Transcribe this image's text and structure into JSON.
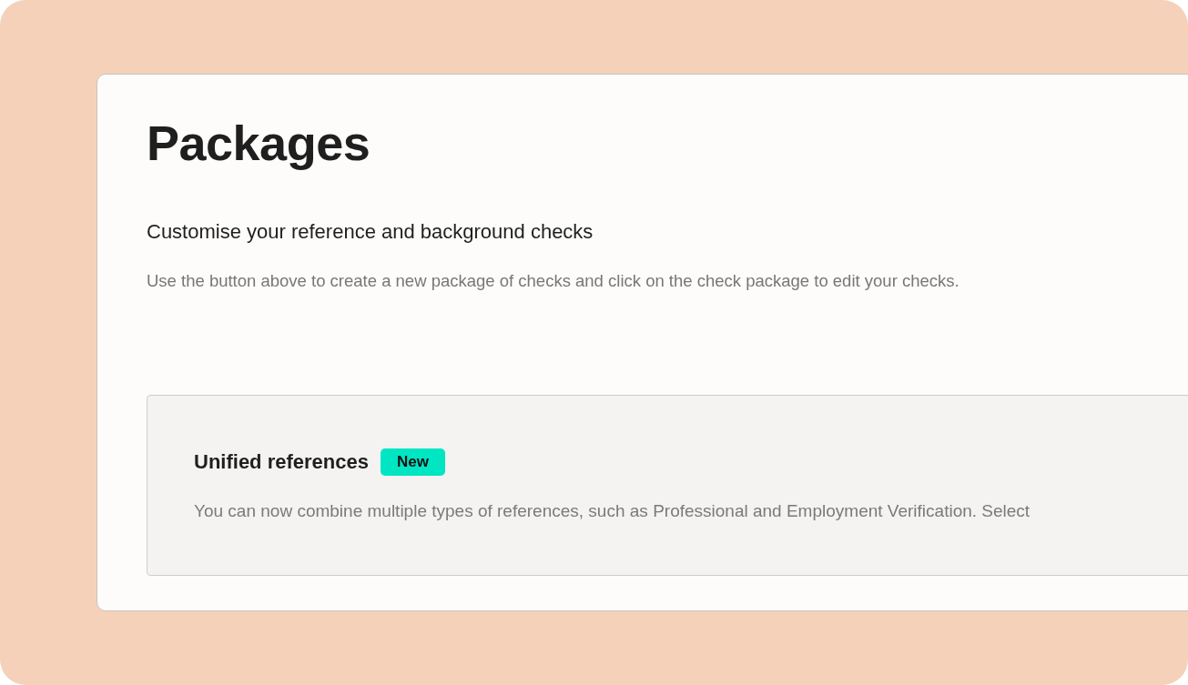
{
  "page": {
    "title": "Packages",
    "subtitle": "Customise your reference and background checks",
    "description": "Use the button above to create a new package of checks and click on the check package to edit your checks."
  },
  "notice": {
    "title": "Unified references",
    "badge": "New",
    "text": "You can now combine multiple types of references, such as Professional and Employment Verification. Select"
  }
}
